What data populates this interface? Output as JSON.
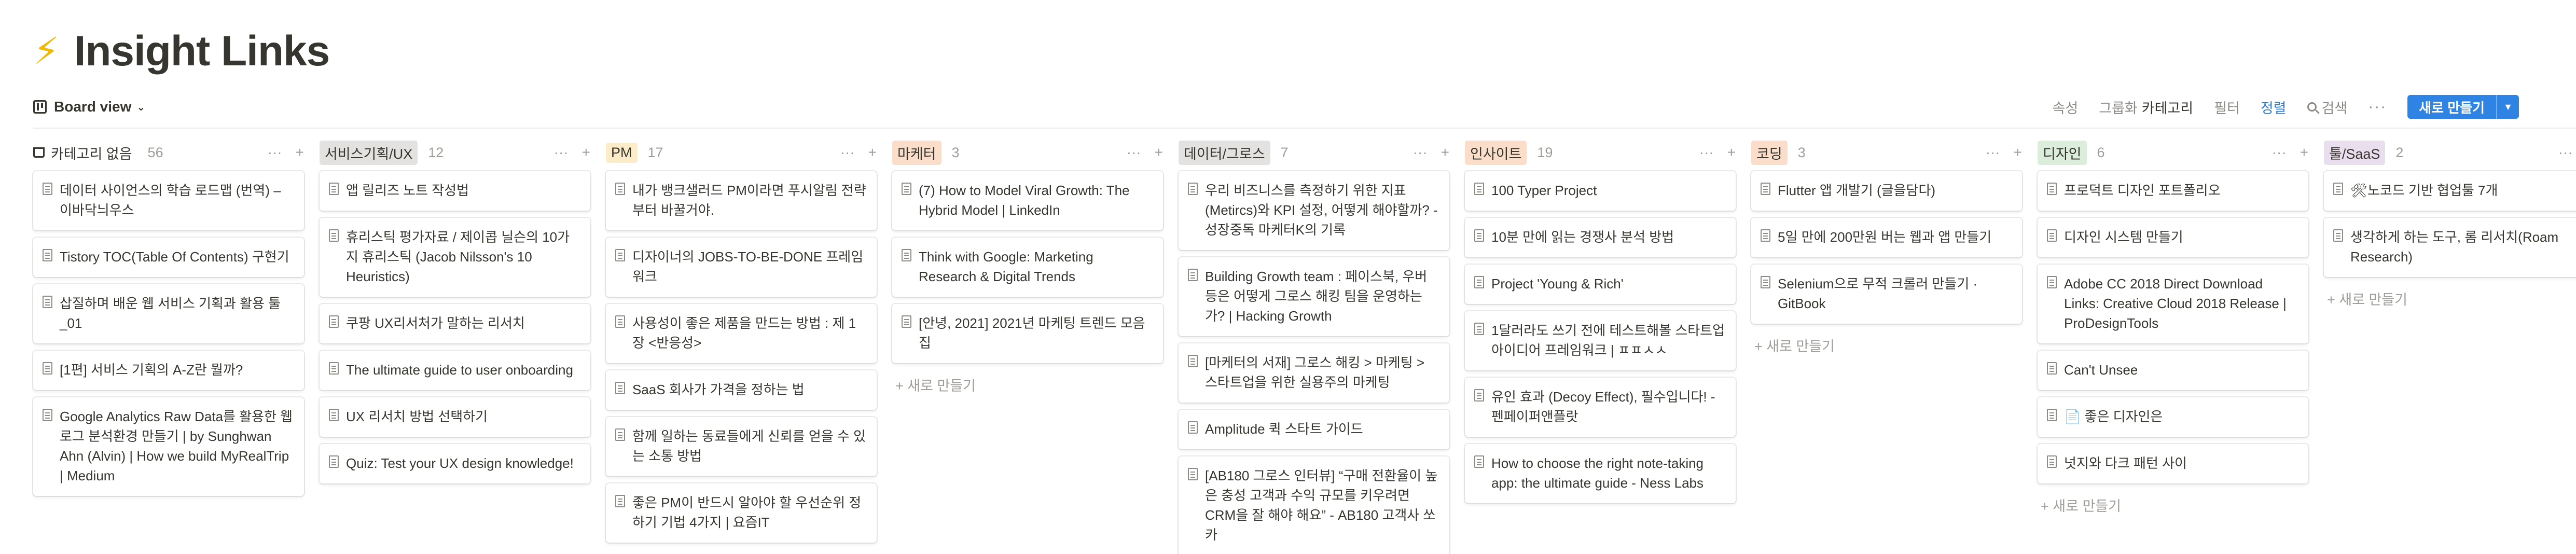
{
  "page": {
    "emoji": "⚡",
    "title": "Insight Links"
  },
  "toolbar": {
    "view_label": "Board view",
    "properties": "속성",
    "group_label": "그룹화",
    "group_value": "카테고리",
    "filter": "필터",
    "sort": "정렬",
    "search": "검색",
    "more": "···",
    "new_button": "새로 만들기"
  },
  "colors": {
    "accent": "#2f83e2",
    "active_tool": "#2e7dd7"
  },
  "add_label": "+ 새로 만들기",
  "columns": [
    {
      "name": "카테고리 없음",
      "count": "56",
      "tag_color": "",
      "cards": [
        "데이터 사이언스의 학습 로드맵 (번역) – 이바닥늬우스",
        "Tistory TOC(Table Of Contents) 구현기",
        "삽질하며 배운 웹 서비스 기획과 활용 툴_01",
        "[1편] 서비스 기획의 A-Z란 뭘까?",
        "Google Analytics Raw Data를 활용한 웹 로그 분석환경 만들기 | by Sunghwan Ahn (Alvin) | How we build MyRealTrip | Medium"
      ]
    },
    {
      "name": "서비스기획/UX",
      "count": "12",
      "tag_color": "#e3e2e0",
      "cards": [
        "앱 릴리즈 노트 작성법",
        "휴리스틱 평가자료 / 제이콥 닐슨의 10가지 휴리스틱 (Jacob Nilsson's 10 Heuristics)",
        "쿠팡 UX리서처가 말하는 리서치",
        "The ultimate guide to user onboarding",
        "UX 리서치 방법 선택하기",
        "Quiz: Test your UX design knowledge!"
      ]
    },
    {
      "name": "PM",
      "count": "17",
      "tag_color": "#fdecc8",
      "cards": [
        "내가 뱅크샐러드 PM이라면 푸시알림 전략부터 바꿀거야.",
        "디자이너의 JOBS-TO-BE-DONE 프레임워크",
        "사용성이 좋은 제품을 만드는 방법 : 제 1장 <반응성>",
        "SaaS 회사가 가격을 정하는 법",
        "함께 일하는 동료들에게 신뢰를 얻을 수 있는 소통 방법",
        "좋은 PM이 반드시 알아야 할 우선순위 정하기 기법 4가지 | 요즘IT"
      ]
    },
    {
      "name": "마케터",
      "count": "3",
      "tag_color": "#fadec9",
      "cards": [
        "(7) How to Model Viral Growth: The Hybrid Model | LinkedIn",
        "Think with Google: Marketing Research & Digital Trends",
        "[안녕, 2021] 2021년 마케팅 트렌드 모음집"
      ],
      "show_add": true
    },
    {
      "name": "데이터/그로스",
      "count": "7",
      "tag_color": "#e3e2e0",
      "cards": [
        "우리 비즈니스를 측정하기 위한 지표(Metircs)와 KPI 설정, 어떻게 해야할까? - 성장중독 마케터K의 기록",
        "Building Growth team : 페이스북, 우버 등은 어떻게 그로스 해킹 팀을 운영하는가? | Hacking Growth",
        "[마케터의 서재] 그로스 해킹 > 마케팅 > 스타트업을 위한 실용주의 마케팅",
        "Amplitude 퀵 스타트 가이드",
        "[AB180 그로스 인터뷰] “구매 전환율이 높은 충성 고객과 수익 규모를 키우려면 CRM을 잘 해야 해요” - AB180 고객사 쏘카"
      ]
    },
    {
      "name": "인사이트",
      "count": "19",
      "tag_color": "#fadec9",
      "cards": [
        "100 Typer Project",
        "10분 만에 읽는 경쟁사 분석 방법",
        "Project 'Young & Rich'",
        "1달러라도 쓰기 전에 테스트해볼 스타트업 아이디어 프레임워크 | ㅍㅍㅅㅅ",
        "유인 효과 (Decoy Effect), 필수입니다! - 펜페이퍼앤플랏",
        "How to choose the right note-taking app: the ultimate guide - Ness Labs"
      ]
    },
    {
      "name": "코딩",
      "count": "3",
      "tag_color": "#fadec9",
      "cards": [
        "Flutter 앱 개발기 (글을담다)",
        "5일 만에 200만원 버는 웹과 앱 만들기",
        "Selenium으로 무적 크롤러 만들기 · GitBook"
      ],
      "show_add": true
    },
    {
      "name": "디자인",
      "count": "6",
      "tag_color": "#dbeddb",
      "cards": [
        "프로덕트 디자인 포트폴리오",
        "디자인 시스템 만들기",
        "Adobe CC 2018 Direct Download Links: Creative Cloud 2018 Release | ProDesignTools",
        "Can't Unsee",
        "📄 좋은 디자인은",
        "넛지와 다크 패턴 사이"
      ],
      "show_add": true
    },
    {
      "name": "툴/SaaS",
      "count": "2",
      "tag_color": "#e8deee",
      "cards": [
        "🛠노코드 기반 협업툴 7개",
        "생각하게 하는 도구, 롬 리서치(Roam Research)"
      ],
      "show_add": true
    }
  ]
}
